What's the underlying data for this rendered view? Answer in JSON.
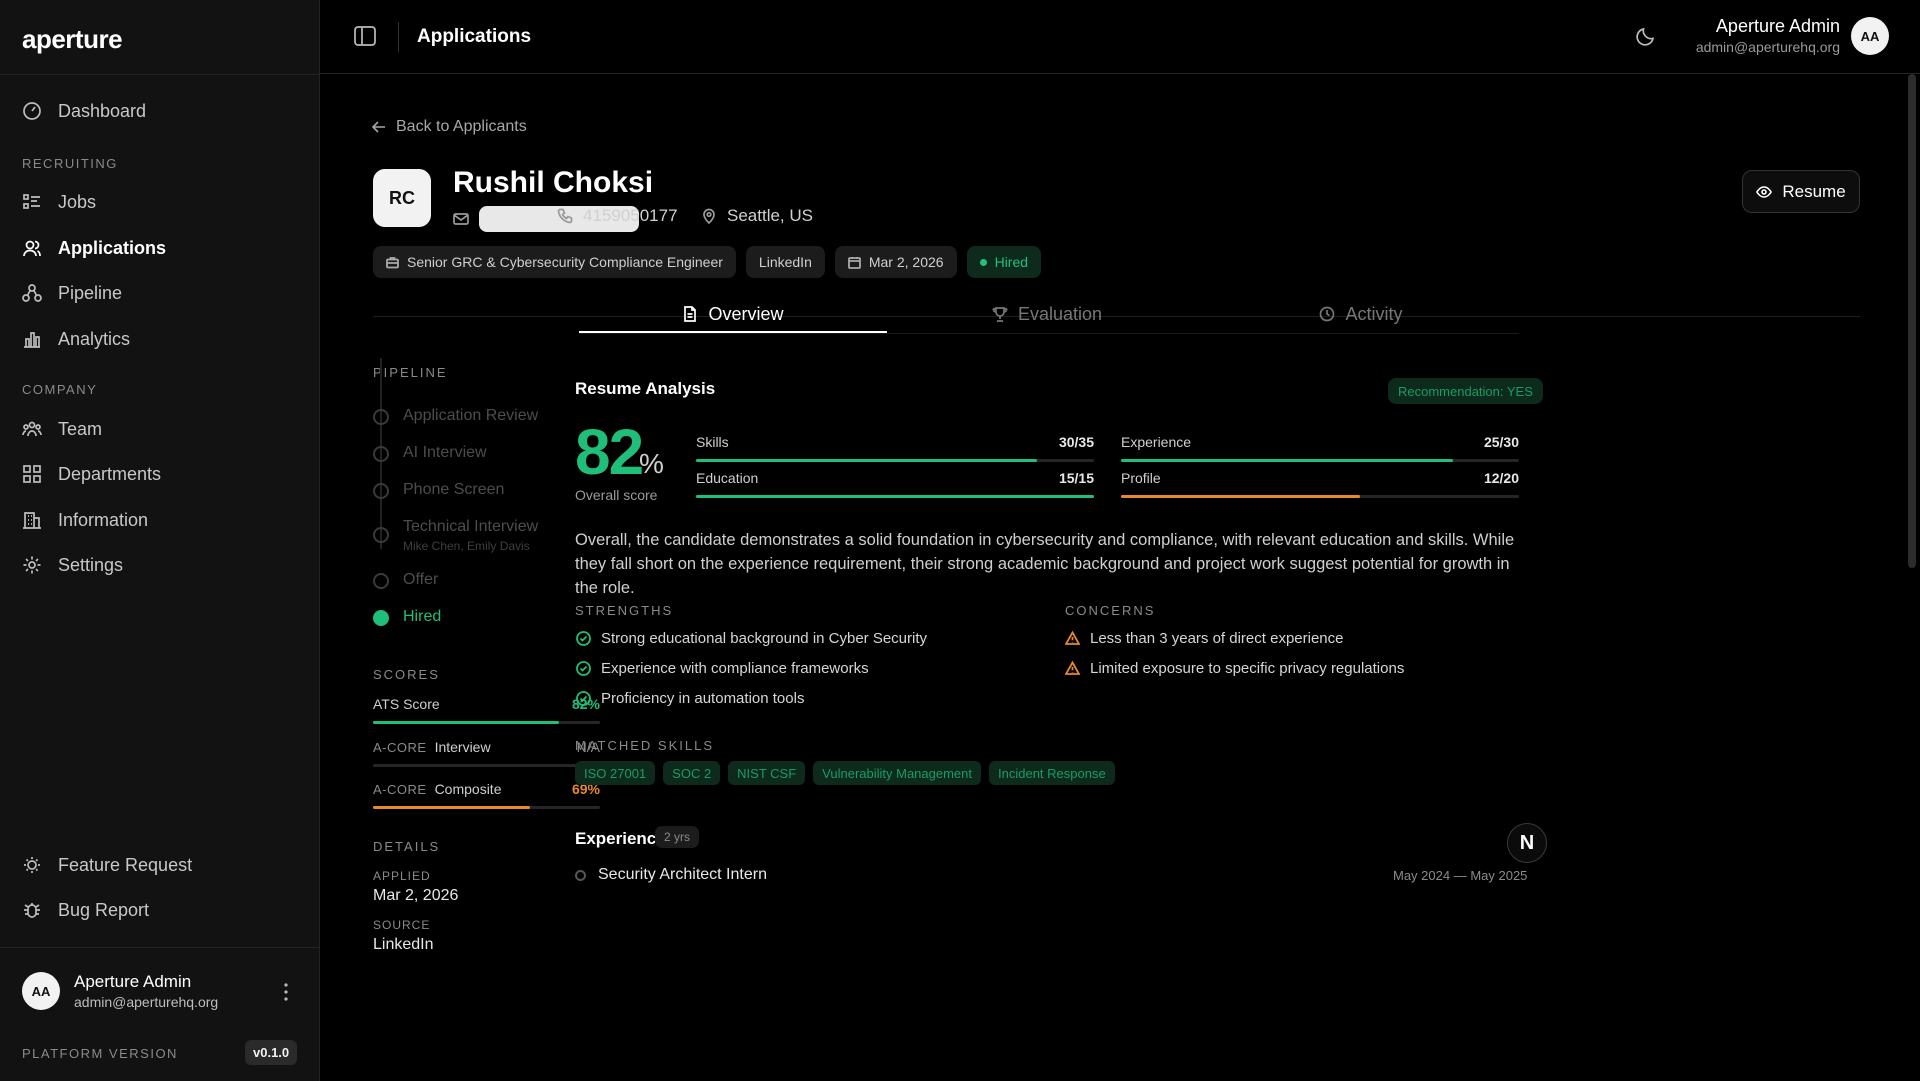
{
  "app": {
    "logo": "aperture"
  },
  "sidebar": {
    "items_top": [
      {
        "label": "Dashboard",
        "icon": "gauge-icon"
      }
    ],
    "sections": [
      {
        "title": "RECRUITING",
        "items": [
          {
            "label": "Jobs",
            "icon": "list-icon"
          },
          {
            "label": "Applications",
            "icon": "users-icon",
            "active": true
          },
          {
            "label": "Pipeline",
            "icon": "pipeline-icon"
          },
          {
            "label": "Analytics",
            "icon": "bar-chart-icon"
          }
        ]
      },
      {
        "title": "COMPANY",
        "items": [
          {
            "label": "Team",
            "icon": "team-icon"
          },
          {
            "label": "Departments",
            "icon": "grid-icon"
          },
          {
            "label": "Information",
            "icon": "building-icon"
          },
          {
            "label": "Settings",
            "icon": "gear-icon"
          }
        ]
      }
    ],
    "footer_items": [
      {
        "label": "Feature Request",
        "icon": "lightbulb-icon"
      },
      {
        "label": "Bug Report",
        "icon": "bug-icon"
      }
    ],
    "user": {
      "initials": "AA",
      "name": "Aperture Admin",
      "email": "admin@aperturehq.org"
    },
    "version_label": "PLATFORM VERSION",
    "version": "v0.1.0"
  },
  "topbar": {
    "title": "Applications",
    "user": {
      "initials": "AA",
      "name": "Aperture Admin",
      "email": "admin@aperturehq.org"
    }
  },
  "candidate": {
    "back_label": "Back to Applicants",
    "initials": "RC",
    "name": "Rushil Choksi",
    "phone": "4159050177",
    "location": "Seattle, US",
    "resume_label": "Resume",
    "role": "Senior GRC & Cybersecurity Compliance Engineer",
    "source": "LinkedIn",
    "date": "Mar 2, 2026",
    "status": "Hired",
    "colors": {
      "accent": "#1fbf7a",
      "warning": "#e8892b"
    }
  },
  "pipeline": {
    "label": "PIPELINE",
    "steps": [
      {
        "label": "Application Review",
        "sub": ""
      },
      {
        "label": "AI Interview",
        "sub": ""
      },
      {
        "label": "Phone Screen",
        "sub": ""
      },
      {
        "label": "Technical Interview",
        "sub": "Mike Chen, Emily Davis"
      },
      {
        "label": "Offer",
        "sub": ""
      },
      {
        "label": "Hired",
        "sub": "",
        "done": true
      }
    ]
  },
  "scores": {
    "label": "SCORES",
    "items": [
      {
        "prefix": "",
        "label": "ATS Score",
        "value": "82%",
        "fraction": 0.82,
        "color": "#1fbf7a"
      },
      {
        "prefix": "A-CORE",
        "label": "Interview",
        "value": "N/A",
        "fraction": 0,
        "color": "#555555"
      },
      {
        "prefix": "A-CORE",
        "label": "Composite",
        "value": "69%",
        "fraction": 0.69,
        "color": "#e8892b"
      }
    ]
  },
  "details": {
    "label": "DETAILS",
    "applied_key": "APPLIED",
    "applied": "Mar 2, 2026",
    "source_key": "SOURCE",
    "source": "LinkedIn"
  },
  "tabs": [
    {
      "label": "Overview",
      "icon": "document-icon",
      "active": true
    },
    {
      "label": "Evaluation",
      "icon": "trophy-icon"
    },
    {
      "label": "Activity",
      "icon": "clock-icon"
    }
  ],
  "analysis": {
    "title": "Resume Analysis",
    "recommendation": "Recommendation: YES",
    "overall_value": "82",
    "overall_unit": "%",
    "overall_label": "Overall score",
    "metrics": [
      {
        "label": "Skills",
        "value": "30/35",
        "fraction": 0.857,
        "color": "#1fbf7a"
      },
      {
        "label": "Experience",
        "value": "25/30",
        "fraction": 0.833,
        "color": "#1fbf7a"
      },
      {
        "label": "Education",
        "value": "15/15",
        "fraction": 1.0,
        "color": "#1fbf7a"
      },
      {
        "label": "Profile",
        "value": "12/20",
        "fraction": 0.6,
        "color": "#e8892b"
      }
    ],
    "summary": "Overall, the candidate demonstrates a solid foundation in cybersecurity and compliance, with relevant education and skills. While they fall short on the experience requirement, their strong academic background and project work suggest potential for growth in the role.",
    "strengths_label": "STRENGTHS",
    "strengths": [
      "Strong educational background in Cyber Security",
      "Experience with compliance frameworks",
      "Proficiency in automation tools"
    ],
    "concerns_label": "CONCERNS",
    "concerns": [
      "Less than 3 years of direct experience",
      "Limited exposure to specific privacy regulations"
    ],
    "skills_label": "MATCHED SKILLS",
    "skills": [
      "ISO 27001",
      "SOC 2",
      "NIST CSF",
      "Vulnerability Management",
      "Incident Response"
    ],
    "experience_title": "Experience",
    "experience_years": "2 yrs",
    "jobs": [
      {
        "title": "Security Architect Intern",
        "dates": "May 2024 — May 2025"
      }
    ]
  },
  "fab_label": "N"
}
